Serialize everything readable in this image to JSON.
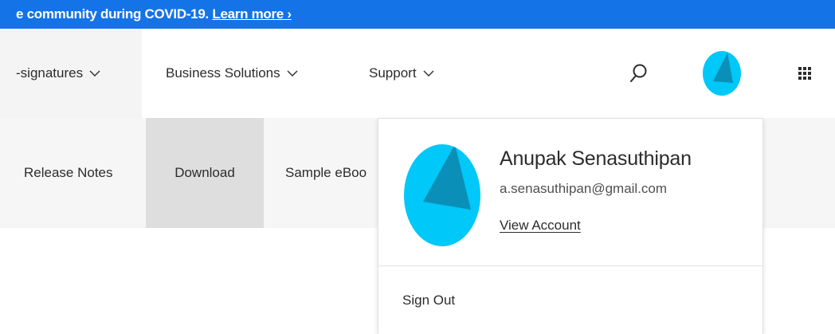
{
  "colors": {
    "banner_bg": "#1473e6",
    "avatar_light": "#00c8f8",
    "avatar_dark": "#0a90b8"
  },
  "banner": {
    "text": "e community during COVID-19.",
    "link": "Learn more ›"
  },
  "topnav": {
    "items": [
      {
        "label": "-signatures"
      },
      {
        "label": "Business Solutions"
      },
      {
        "label": "Support"
      }
    ],
    "search_icon": "search-icon",
    "avatar_icon": "avatar-icon",
    "apps_icon": "app-grid-icon"
  },
  "subnav": {
    "items": [
      {
        "label": "Release Notes"
      },
      {
        "label": "Download",
        "active": true
      },
      {
        "label": "Sample eBoo"
      }
    ]
  },
  "profile": {
    "name": "Anupak Senasuthipan",
    "email": "a.senasuthipan@gmail.com",
    "view_account": "View Account",
    "sign_out": "Sign Out"
  }
}
